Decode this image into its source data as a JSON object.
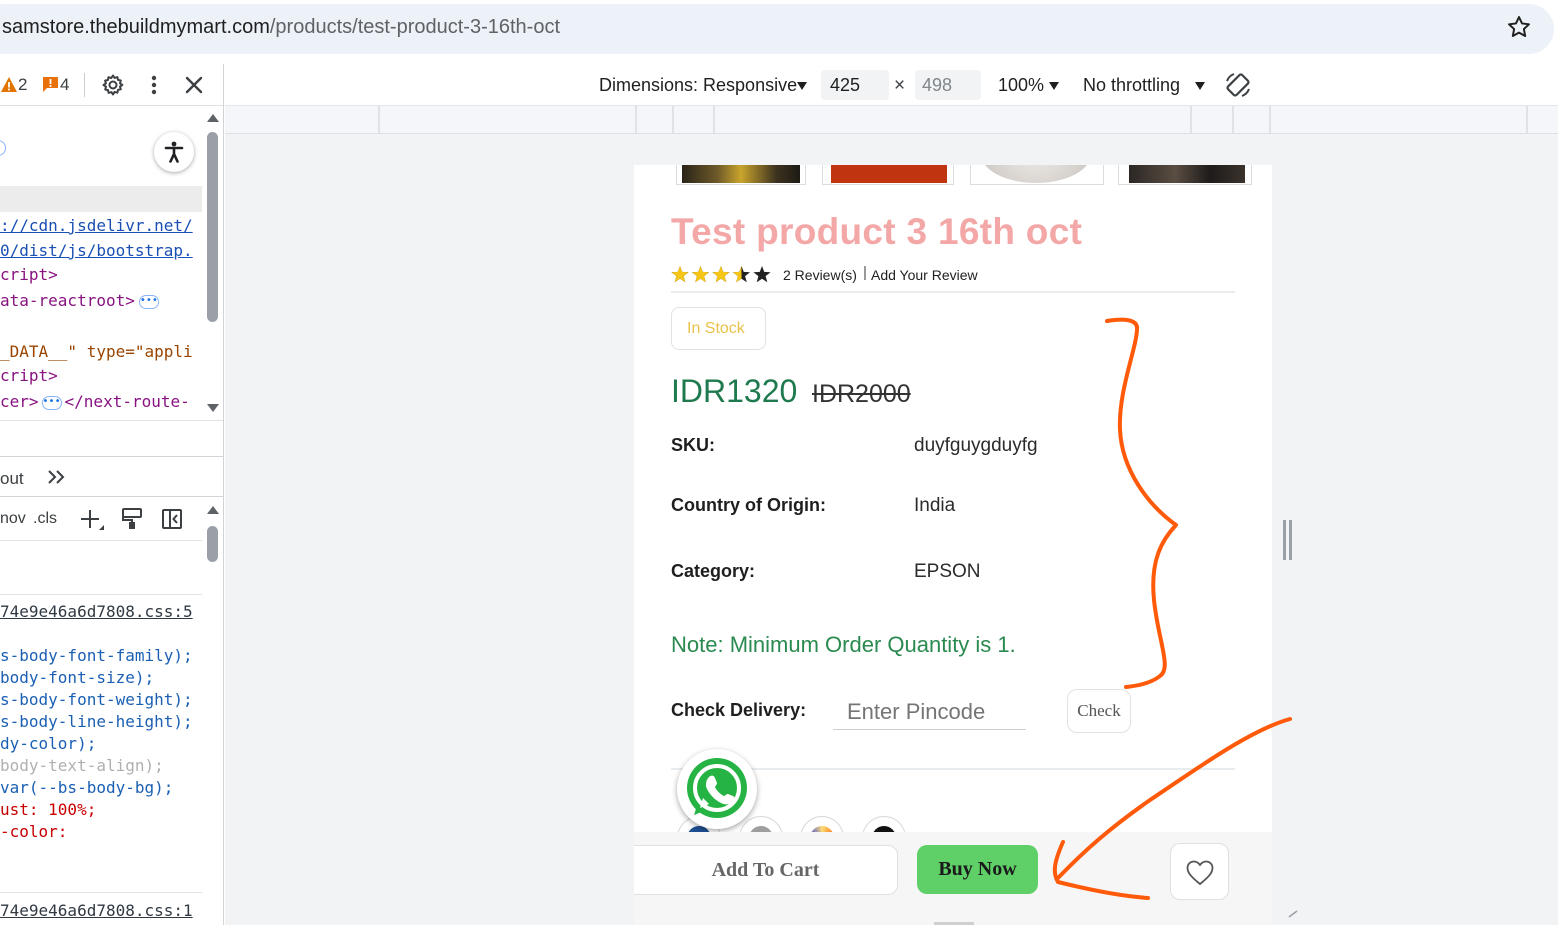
{
  "browser": {
    "url_host": "samstore.thebuildmymart.com",
    "url_path": "/products/test-product-3-16th-oct"
  },
  "devtools": {
    "warnings_count": "2",
    "issues_count": "4",
    "elements_lines": [
      {
        "text": "://cdn.jsdelivr.net/",
        "kind": "link"
      },
      {
        "text": "0/dist/js/bootstrap.",
        "kind": "link"
      },
      {
        "text": "cript>",
        "kind": "tag"
      },
      {
        "text": "ata-reactroot>",
        "kind": "tag"
      },
      {
        "text": "_DATA__\" type=\"appli",
        "kind": "attr"
      },
      {
        "text": "cript>",
        "kind": "tag"
      },
      {
        "text": "cer>",
        "kind": "tag"
      },
      {
        "text": "</next-route-",
        "kind": "tag"
      }
    ],
    "styles_tabs_label": "out",
    "filter_hov": "nov",
    "filter_cls": ".cls",
    "css_source_1": "74e9e46a6d7808.css:5",
    "css_source_2": "74e9e46a6d7808.css:1",
    "css_lines": [
      {
        "text": "s-body-font-family);",
        "kind": "var"
      },
      {
        "text": "body-font-size);",
        "kind": "var"
      },
      {
        "text": "s-body-font-weight);",
        "kind": "var"
      },
      {
        "text": "s-body-line-height);",
        "kind": "var"
      },
      {
        "text": "dy-color);",
        "kind": "var"
      },
      {
        "text": "body-text-align);",
        "kind": "muted"
      },
      {
        "text": "var(--bs-body-bg);",
        "kind": "var"
      },
      {
        "text": "ust: 100%;",
        "kind": "prop"
      },
      {
        "text": "-color:",
        "kind": "prop"
      }
    ]
  },
  "device_toolbar": {
    "dimensions_label": "Dimensions: Responsive",
    "width": "425",
    "height": "498",
    "zoom": "100%",
    "throttling": "No throttling"
  },
  "product": {
    "title": "Test product 3 16th oct",
    "rating": 3.5,
    "rating_max": 5,
    "reviews_text": "2 Review(s)",
    "add_review_text": "Add Your Review",
    "stock_badge": "In Stock",
    "price": "IDR1320",
    "old_price": "IDR2000",
    "sku_label": "SKU:",
    "sku_value": "duyfguygduyfg",
    "origin_label": "Country of Origin:",
    "origin_value": "India",
    "category_label": "Category:",
    "category_value": "EPSON",
    "note": "Note: Minimum Order Quantity is 1.",
    "delivery_label": "Check Delivery:",
    "pincode_placeholder": "Enter Pincode",
    "check_button": "Check",
    "add_to_cart": "Add To Cart",
    "buy_now": "Buy Now"
  },
  "colors": {
    "title_pink": "#f3a7a7",
    "price_green": "#1e7a4e",
    "note_green": "#2a8a4f",
    "buy_now_green": "#5fd068",
    "stock_yellow": "#e8c24a",
    "annotation_orange": "#ff5a0a"
  }
}
